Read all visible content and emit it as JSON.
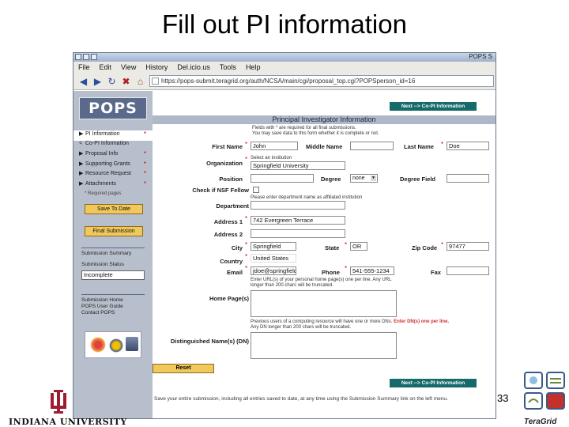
{
  "slide": {
    "title": "Fill out PI information",
    "page_number": "33",
    "iu_name": "INDIANA UNIVERSITY",
    "teragrid_name": "TeraGrid"
  },
  "browser": {
    "window_title": "POPS S",
    "menu": [
      "File",
      "Edit",
      "View",
      "History",
      "Del.icio.us",
      "Tools",
      "Help"
    ],
    "url": "https://pops-submit.teragrid.org/auth/NCSA/main/cgi/proposal_top.cgi?POPSperson_id=16"
  },
  "sidebar": {
    "logo": "POPS",
    "nav": [
      {
        "label": "PI Information",
        "arrow": "▶",
        "star": "*",
        "active": true
      },
      {
        "label": "Co-PI Information",
        "arrow": "<",
        "star": "",
        "active": false
      },
      {
        "label": "Proposal Info",
        "arrow": "▶",
        "star": "*",
        "active": false
      },
      {
        "label": "Supporting Grants",
        "arrow": "▶",
        "star": "*",
        "active": false
      },
      {
        "label": "Resource Request",
        "arrow": "▶",
        "star": "*",
        "active": false
      },
      {
        "label": "Attachments",
        "arrow": "▶",
        "star": "*",
        "active": false
      }
    ],
    "required_note": "Required pages",
    "save_button": "Save To Date",
    "final_button": "Final Submission",
    "summary_link": "Submission Summary",
    "status_label": "Submission Status",
    "status_value": "Incomplete",
    "links": [
      "Submission Home",
      "POPS User Guide",
      "Contact POPS"
    ]
  },
  "main": {
    "next_button": "Next --> Co-PI Information",
    "section_title": "Principal Investigator Information",
    "intro": [
      "Fields with * are required for all final submissions.",
      "You may save data to this form whether it is complete or not."
    ],
    "labels": {
      "first_name": "First Name",
      "middle_name": "Middle Name",
      "last_name": "Last Name",
      "organization": "Organization",
      "position": "Position",
      "degree": "Degree",
      "degree_field": "Degree Field",
      "nsf_fellow": "Check if NSF Fellow",
      "department": "Department",
      "address1": "Address 1",
      "address2": "Address 2",
      "city": "City",
      "state": "State",
      "zip": "Zip Code",
      "country": "Country",
      "phone": "Phone",
      "email": "Email",
      "fax": "Fax",
      "home_pages": "Home Page(s)",
      "dn": "Distinguished Name(s) (DN)"
    },
    "values": {
      "first_name": "John",
      "middle_name": "",
      "last_name": "Doe",
      "organization": "Springfield University",
      "position": "",
      "degree": "none",
      "degree_field": "",
      "department": "",
      "address1": "742 Evergreen Terrace",
      "address2": "",
      "city": "Springfield",
      "state": "OR",
      "zip": "97477",
      "country": "United States",
      "phone": "541-555-1234",
      "email": "jdoe@springfield.edu",
      "fax": ""
    },
    "notes": {
      "organization": "Select an institution",
      "department": "Please enter department name as affiliated institution",
      "home_pages": "Enter URL(s) of your personal home page(s) one per line. Any URL longer than 200 chars will be truncated.",
      "dn_line1": "Previous users of a computing resource will have one or more DNs.",
      "dn_hint": "Enter DN(s) one per line.",
      "dn_line2": "Any DN longer than 200 chars will be truncated."
    },
    "reset_button": "Reset",
    "footer": "Save your entire submission, including all entries saved to date, at any time using the Submission Summary link on the left menu."
  },
  "colors": {
    "sidebar_bg": "#b8bfcc",
    "button_gold": "#f0c85c",
    "next_teal": "#166a6a",
    "required_red": "#cc0000"
  },
  "icons": [
    "back-arrow-icon",
    "forward-arrow-icon",
    "reload-icon",
    "stop-icon",
    "home-icon",
    "page-icon"
  ]
}
